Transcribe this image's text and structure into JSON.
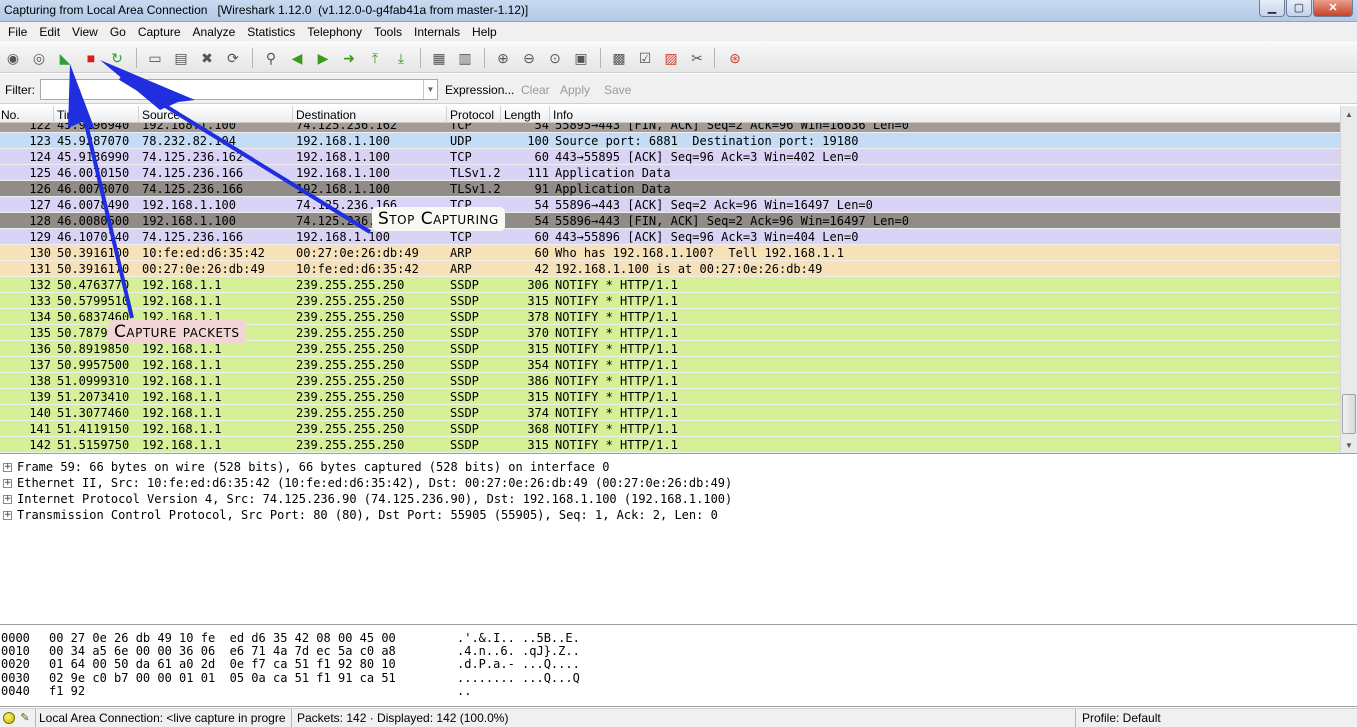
{
  "window": {
    "title": "Capturing from Local Area Connection   [Wireshark 1.12.0  (v1.12.0-0-g4fab41a from master-1.12)]",
    "min_glyph": "▁",
    "max_glyph": "▢",
    "close_glyph": "✕"
  },
  "menu": [
    "File",
    "Edit",
    "View",
    "Go",
    "Capture",
    "Analyze",
    "Statistics",
    "Telephony",
    "Tools",
    "Internals",
    "Help"
  ],
  "toolbar": {
    "icons": [
      "interface-list-icon",
      "capture-options-icon",
      "start-capture-icon",
      "stop-capture-icon",
      "restart-capture-icon",
      "open-file-icon",
      "save-file-icon",
      "close-file-icon",
      "reload-file-icon",
      "find-packet-icon",
      "go-back-icon",
      "go-forward-icon",
      "go-to-packet-icon",
      "go-first-icon",
      "go-last-icon",
      "colorize-icon",
      "auto-scroll-icon",
      "zoom-in-icon",
      "zoom-out-icon",
      "normal-size-icon",
      "resize-columns-icon",
      "capture-filters-icon",
      "display-filters-icon",
      "coloring-rules-icon",
      "preferences-icon",
      "help-icon"
    ],
    "glyphs": {
      "interface-list-icon": "◉",
      "capture-options-icon": "◎",
      "start-capture-icon": "◣",
      "stop-capture-icon": "■",
      "restart-capture-icon": "↻",
      "open-file-icon": "▭",
      "save-file-icon": "▤",
      "close-file-icon": "✖",
      "reload-file-icon": "⟳",
      "find-packet-icon": "⚲",
      "go-back-icon": "◀",
      "go-forward-icon": "▶",
      "go-to-packet-icon": "➜",
      "go-first-icon": "⤒",
      "go-last-icon": "⤓",
      "colorize-icon": "▦",
      "auto-scroll-icon": "▥",
      "zoom-in-icon": "⊕",
      "zoom-out-icon": "⊖",
      "normal-size-icon": "⊙",
      "resize-columns-icon": "▣",
      "capture-filters-icon": "▩",
      "display-filters-icon": "☑",
      "coloring-rules-icon": "▨",
      "preferences-icon": "✂",
      "help-icon": "⊛"
    },
    "colors": {
      "start-capture-icon": "#2f9e33",
      "stop-capture-icon": "#e0191b",
      "restart-capture-icon": "#2f9e33",
      "go-back-icon": "#3a9a1e",
      "go-forward-icon": "#3a9a1e",
      "go-to-packet-icon": "#3a9a1e",
      "go-first-icon": "#3a9a1e",
      "go-last-icon": "#3a9a1e",
      "coloring-rules-icon": "#d43b2a",
      "help-icon": "#d43b2a"
    }
  },
  "filter": {
    "label": "Filter:",
    "value": "",
    "expression_label": "Expression...",
    "clear_label": "Clear",
    "apply_label": "Apply",
    "save_label": "Save"
  },
  "packet_list": {
    "columns": [
      "No.",
      "Time",
      "Source",
      "Destination",
      "Protocol",
      "Length",
      "Info"
    ],
    "rows": [
      {
        "no": "122",
        "time": "45.9196940",
        "src": "192.168.1.100",
        "dst": "74.125.236.162",
        "proto": "TCP",
        "len": "54",
        "info": "55895→443 [FIN, ACK] Seq=2 Ack=96 Win=16636 Len=0",
        "bg": "#a39b94"
      },
      {
        "no": "123",
        "time": "45.9287070",
        "src": "78.232.82.104",
        "dst": "192.168.1.100",
        "proto": "UDP",
        "len": "100",
        "info": "Source port: 6881  Destination port: 19180",
        "bg": "#c4dcf6"
      },
      {
        "no": "124",
        "time": "45.9136990",
        "src": "74.125.236.162",
        "dst": "192.168.1.100",
        "proto": "TCP",
        "len": "60",
        "info": "443→55895 [ACK] Seq=96 Ack=3 Win=402 Len=0",
        "bg": "#d9d4f6"
      },
      {
        "no": "125",
        "time": "46.0070150",
        "src": "74.125.236.166",
        "dst": "192.168.1.100",
        "proto": "TLSv1.2",
        "len": "111",
        "info": "Application Data",
        "bg": "#d9d4f6"
      },
      {
        "no": "126",
        "time": "46.0078070",
        "src": "74.125.236.166",
        "dst": "192.168.1.100",
        "proto": "TLSv1.2",
        "len": "91",
        "info": "Application Data",
        "bg": "#918c87"
      },
      {
        "no": "127",
        "time": "46.0078490",
        "src": "192.168.1.100",
        "dst": "74.125.236.166",
        "proto": "TCP",
        "len": "54",
        "info": "55896→443 [ACK] Seq=2 Ack=96 Win=16497 Len=0",
        "bg": "#d9d4f6"
      },
      {
        "no": "128",
        "time": "46.0080500",
        "src": "192.168.1.100",
        "dst": "74.125.236.166",
        "proto": "TCP",
        "len": "54",
        "info": "55896→443 [FIN, ACK] Seq=2 Ack=96 Win=16497 Len=0",
        "bg": "#918c87"
      },
      {
        "no": "129",
        "time": "46.1070140",
        "src": "74.125.236.166",
        "dst": "192.168.1.100",
        "proto": "TCP",
        "len": "60",
        "info": "443→55896 [ACK] Seq=96 Ack=3 Win=404 Len=0",
        "bg": "#d9d4f6"
      },
      {
        "no": "130",
        "time": "50.3916100",
        "src": "10:fe:ed:d6:35:42",
        "dst": "00:27:0e:26:db:49",
        "proto": "ARP",
        "len": "60",
        "info": "Who has 192.168.1.100?  Tell 192.168.1.1",
        "bg": "#f7e1b8"
      },
      {
        "no": "131",
        "time": "50.3916170",
        "src": "00:27:0e:26:db:49",
        "dst": "10:fe:ed:d6:35:42",
        "proto": "ARP",
        "len": "42",
        "info": "192.168.1.100 is at 00:27:0e:26:db:49",
        "bg": "#f7e1b8"
      },
      {
        "no": "132",
        "time": "50.4763770",
        "src": "192.168.1.1",
        "dst": "239.255.255.250",
        "proto": "SSDP",
        "len": "306",
        "info": "NOTIFY * HTTP/1.1",
        "bg": "#d5f096"
      },
      {
        "no": "133",
        "time": "50.5799510",
        "src": "192.168.1.1",
        "dst": "239.255.255.250",
        "proto": "SSDP",
        "len": "315",
        "info": "NOTIFY * HTTP/1.1",
        "bg": "#d5f096"
      },
      {
        "no": "134",
        "time": "50.6837460",
        "src": "192.168.1.1",
        "dst": "239.255.255.250",
        "proto": "SSDP",
        "len": "378",
        "info": "NOTIFY * HTTP/1.1",
        "bg": "#d5f096"
      },
      {
        "no": "135",
        "time": "50.7879440",
        "src": "192.168.1.1",
        "dst": "239.255.255.250",
        "proto": "SSDP",
        "len": "370",
        "info": "NOTIFY * HTTP/1.1",
        "bg": "#d5f096"
      },
      {
        "no": "136",
        "time": "50.8919850",
        "src": "192.168.1.1",
        "dst": "239.255.255.250",
        "proto": "SSDP",
        "len": "315",
        "info": "NOTIFY * HTTP/1.1",
        "bg": "#d5f096"
      },
      {
        "no": "137",
        "time": "50.9957500",
        "src": "192.168.1.1",
        "dst": "239.255.255.250",
        "proto": "SSDP",
        "len": "354",
        "info": "NOTIFY * HTTP/1.1",
        "bg": "#d5f096"
      },
      {
        "no": "138",
        "time": "51.0999310",
        "src": "192.168.1.1",
        "dst": "239.255.255.250",
        "proto": "SSDP",
        "len": "386",
        "info": "NOTIFY * HTTP/1.1",
        "bg": "#d5f096"
      },
      {
        "no": "139",
        "time": "51.2073410",
        "src": "192.168.1.1",
        "dst": "239.255.255.250",
        "proto": "SSDP",
        "len": "315",
        "info": "NOTIFY * HTTP/1.1",
        "bg": "#d5f096"
      },
      {
        "no": "140",
        "time": "51.3077460",
        "src": "192.168.1.1",
        "dst": "239.255.255.250",
        "proto": "SSDP",
        "len": "374",
        "info": "NOTIFY * HTTP/1.1",
        "bg": "#d5f096"
      },
      {
        "no": "141",
        "time": "51.4119150",
        "src": "192.168.1.1",
        "dst": "239.255.255.250",
        "proto": "SSDP",
        "len": "368",
        "info": "NOTIFY * HTTP/1.1",
        "bg": "#d5f096"
      },
      {
        "no": "142",
        "time": "51.5159750",
        "src": "192.168.1.1",
        "dst": "239.255.255.250",
        "proto": "SSDP",
        "len": "315",
        "info": "NOTIFY * HTTP/1.1",
        "bg": "#d5f096"
      }
    ]
  },
  "details": {
    "expand_glyph": "+",
    "rows": [
      "Frame 59: 66 bytes on wire (528 bits), 66 bytes captured (528 bits) on interface 0",
      "Ethernet II, Src: 10:fe:ed:d6:35:42 (10:fe:ed:d6:35:42), Dst: 00:27:0e:26:db:49 (00:27:0e:26:db:49)",
      "Internet Protocol Version 4, Src: 74.125.236.90 (74.125.236.90), Dst: 192.168.1.100 (192.168.1.100)",
      "Transmission Control Protocol, Src Port: 80 (80), Dst Port: 55905 (55905), Seq: 1, Ack: 2, Len: 0"
    ]
  },
  "bytes": [
    {
      "offset": "0000",
      "hex": "00 27 0e 26 db 49 10 fe  ed d6 35 42 08 00 45 00",
      "ascii": ".'.&.I.. ..5B..E."
    },
    {
      "offset": "0010",
      "hex": "00 34 a5 6e 00 00 36 06  e6 71 4a 7d ec 5a c0 a8",
      "ascii": ".4.n..6. .qJ}.Z.."
    },
    {
      "offset": "0020",
      "hex": "01 64 00 50 da 61 a0 2d  0e f7 ca 51 f1 92 80 10",
      "ascii": ".d.P.a.- ...Q...."
    },
    {
      "offset": "0030",
      "hex": "02 9e c0 b7 00 00 01 01  05 0a ca 51 f1 91 ca 51",
      "ascii": "........ ...Q...Q"
    },
    {
      "offset": "0040",
      "hex": "f1 92",
      "ascii": ".."
    }
  ],
  "status": {
    "interface": "Local Area Connection: <live capture in progre",
    "packets": "Packets: 142 · Displayed: 142 (100.0%)",
    "profile": "Profile: Default"
  },
  "annotations": {
    "stop": "Stop Capturing",
    "capture": "Capture packets",
    "arrow_color": "#1f2fe0"
  }
}
